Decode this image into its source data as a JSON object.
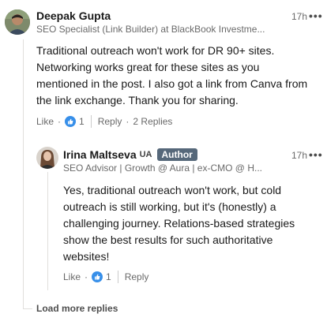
{
  "comment": {
    "author_name": "Deepak Gupta",
    "headline": "SEO Specialist (Link Builder) at BlackBook Investme...",
    "time": "17h",
    "more_label": "•••",
    "text_lines": [
      "Traditional outreach won't work for DR 90+ sites.",
      "Networking works great for these sites as you",
      "mentioned in the post. I also got a link from Canva from",
      "the link exchange. Thank you for sharing."
    ],
    "like_label": "Like",
    "dot": "·",
    "reaction_count": "1",
    "reply_label": "Reply",
    "replies_count": "2 Replies"
  },
  "reply": {
    "author_name": "Irina Maltseva",
    "country_code": "UA",
    "author_badge": "Author",
    "headline": "SEO Advisor | Growth @ Aura | ex-CMO @ H...",
    "time": "17h",
    "more_label": "•••",
    "text_lines": [
      "Yes, traditional outreach won't work, but cold",
      "outreach is still working, but it's (honestly) a",
      "challenging journey. Relations-based strategies",
      "show the best results for such authoritative",
      "websites!"
    ],
    "like_label": "Like",
    "dot": "·",
    "reaction_count": "1",
    "reply_label": "Reply"
  },
  "load_more_label": "Load more replies",
  "colors": {
    "reaction_blue": "#378fe9",
    "badge_bg": "#56687a",
    "thread_line": "#e0dfdc"
  }
}
